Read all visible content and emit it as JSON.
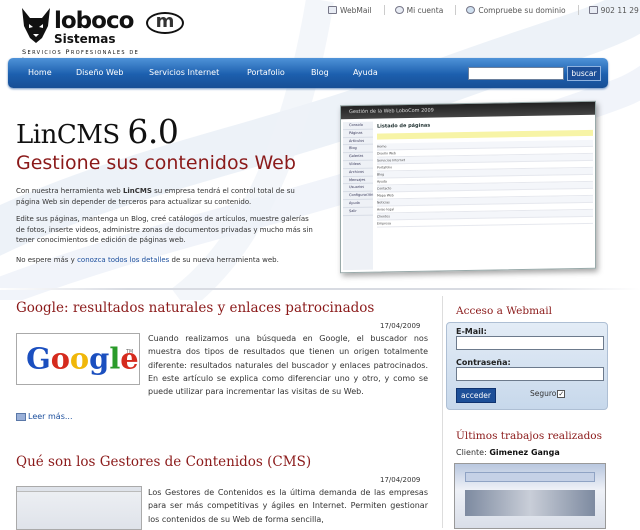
{
  "logo": {
    "word": "loboco",
    "m": "m",
    "sub": "Sistemas",
    "tagline": "Servicios Profesionales de Internet"
  },
  "toplinks": [
    {
      "label": "WebMail",
      "icon": "mail-icon"
    },
    {
      "label": "Mi cuenta",
      "icon": "user-icon"
    },
    {
      "label": "Compruebe su dominio",
      "icon": "globe-icon"
    },
    {
      "label": "902 11 29 27",
      "icon": "phone-icon"
    }
  ],
  "nav": {
    "items": [
      "Home",
      "Diseño Web",
      "Servicios Internet",
      "Portafolio",
      "Blog",
      "Ayuda"
    ],
    "search_button": "buscar"
  },
  "hero": {
    "title": "LinCMS",
    "version": "6.0",
    "subtitle": "Gestione sus contenidos Web",
    "p1_pre": "Con nuestra herramienta web ",
    "p1_bold": "LinCMS",
    "p1_post": " su empresa tendrá el control total de su página Web sin depender de terceros para actualizar su contenido.",
    "p2": "Edite sus páginas, mantenga un Blog, creé catálogos de artículos, muestre galerías de fotos, inserte videos, administre zonas de documentos privadas y mucho más sin tener conocimientos de edición de páginas web.",
    "p3_pre": "No espere más y ",
    "p3_link": "conozca todos los detalles",
    "p3_post": " de su nueva herramienta web."
  },
  "screenshot": {
    "window_title": "Gestión de la Web LoboCom 2009",
    "heading": "Listado de páginas",
    "menu": [
      "Consola",
      "Páginas",
      "Artículos",
      "Blog",
      "Galerías",
      "Vídeos",
      "Archivos",
      "Mensajes",
      "Usuarios",
      "Configuración",
      "Ayuda",
      "Salir"
    ],
    "rows": [
      "Home",
      "Diseño Web",
      "Servicios Internet",
      "Portafolio",
      "Blog",
      "Ayuda",
      "Contacto",
      "Mapa Web",
      "Noticias",
      "Aviso legal",
      "Clientes",
      "Empresa"
    ]
  },
  "posts": [
    {
      "title": "Google: resultados naturales y enlaces patrocinados",
      "date": "17/04/2009",
      "image": "Google",
      "text": "Cuando realizamos una búsqueda en Google, el buscador nos muestra dos tipos de resultados que tienen un origen totalmente diferente: resultados naturales del buscador y enlaces patrocinados. En este artículo se explica como diferenciar uno y otro, y como se puede utilizar para incrementar las visitas de su Web.",
      "readmore": "Leer más..."
    },
    {
      "title": "Qué son los Gestores de Contenidos (CMS)",
      "date": "17/04/2009",
      "text": "Los Gestores de Contenidos es la última demanda de las empresas para ser más competitivas y ágiles en Internet. Permiten gestionar los contenidos de su Web de forma sencilla,"
    }
  ],
  "sidebar": {
    "webmail_title": "Acceso a Webmail",
    "email_label": "E-Mail:",
    "password_label": "Contraseña:",
    "submit": "acceder",
    "secure_label": "Seguro",
    "works_title": "Últimos trabajos realizados",
    "client_prefix": "Cliente: ",
    "client_name": "Gimenez Ganga"
  },
  "colors": {
    "nav": "#1c5fae",
    "accent_red": "#8b1a1a",
    "link": "#1b4e9c"
  }
}
